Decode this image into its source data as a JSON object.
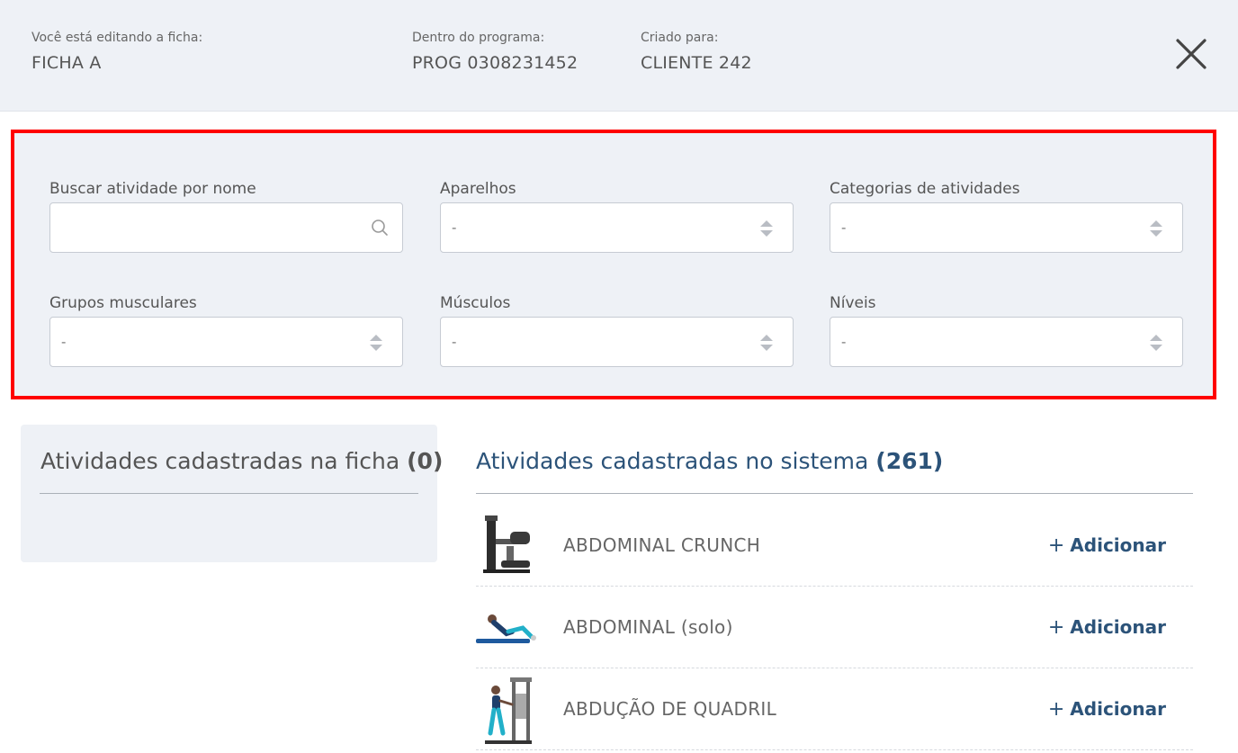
{
  "header": {
    "editing_label": "Você está editando a ficha:",
    "editing_value": "FICHA A",
    "program_label": "Dentro do programa:",
    "program_value": "PROG 0308231452",
    "client_label": "Criado para:",
    "client_value": "CLIENTE 242"
  },
  "filters": {
    "search_label": "Buscar atividade por nome",
    "search_placeholder": "",
    "aparelhos_label": "Aparelhos",
    "aparelhos_value": "-",
    "categorias_label": "Categorias de atividades",
    "categorias_value": "-",
    "grupos_label": "Grupos musculares",
    "grupos_value": "-",
    "musculos_label": "Músculos",
    "musculos_value": "-",
    "niveis_label": "Níveis",
    "niveis_value": "-"
  },
  "ficha_panel": {
    "title": "Atividades cadastradas na ficha",
    "count": "(0)"
  },
  "system_panel": {
    "title": "Atividades cadastradas no sistema",
    "count": "(261)",
    "add_label": "Adicionar",
    "items": [
      {
        "name": "ABDOMINAL CRUNCH"
      },
      {
        "name": "ABDOMINAL (solo)"
      },
      {
        "name": "ABDUÇÃO DE QUADRIL"
      }
    ]
  },
  "icons": {
    "close": "close-icon",
    "search": "search-icon",
    "select_arrows": "sort-arrows-icon"
  },
  "colors": {
    "accent": "#2c5379",
    "highlight_border": "#ff0000",
    "panel_bg": "#eef1f6"
  }
}
